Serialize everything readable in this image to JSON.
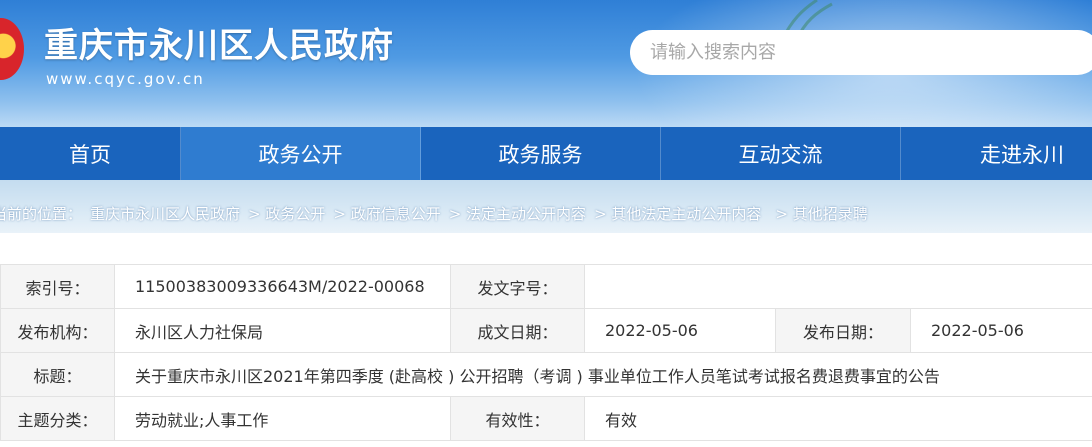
{
  "header": {
    "site_title": "重庆市永川区人民政府",
    "site_url": "www.cqyc.gov.cn",
    "search_placeholder": "请输入搜索内容"
  },
  "nav": {
    "items": [
      {
        "label": "首页"
      },
      {
        "label": "政务公开",
        "active": true
      },
      {
        "label": "政务服务"
      },
      {
        "label": "互动交流"
      },
      {
        "label": "走进永川"
      }
    ]
  },
  "breadcrumb": {
    "prefix": "当前的位置：",
    "items": [
      "重庆市永川区人民政府",
      "> 政务公开",
      "> 政府信息公开",
      "> 法定主动公开内容",
      "> 其他法定主动公开内容",
      "> 其他招录聘"
    ]
  },
  "info": {
    "index_label": "索引号：",
    "index_value": "11500383009336643M/2022-00068",
    "docno_label": "发文字号：",
    "docno_value": "",
    "publisher_label": "发布机构：",
    "publisher_value": "永川区人力社保局",
    "created_label": "成文日期：",
    "created_value": "2022-05-06",
    "published_label": "发布日期：",
    "published_value": "2022-05-06",
    "title_label": "标题：",
    "title_value": "关于重庆市永川区2021年第四季度 (赴高校 ) 公开招聘（考调 ) 事业单位工作人员笔试考试报名费退费事宜的公告",
    "topic_label": "主题分类：",
    "topic_value": "劳动就业;人事工作",
    "validity_label": "有效性：",
    "validity_value": "有效"
  },
  "colors": {
    "nav_bg": "#1a64bd",
    "nav_active": "#2f7cd0",
    "header_top": "#2f7fd6",
    "label_bg": "#f5f5f5"
  }
}
